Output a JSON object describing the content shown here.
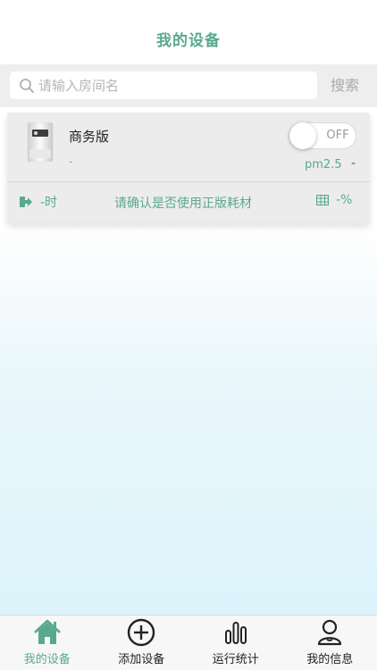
{
  "header": {
    "title": "我的设备"
  },
  "search": {
    "placeholder": "请输入房间名",
    "value": "",
    "button_label": "搜索"
  },
  "device": {
    "name": "商务版",
    "subtitle": "-",
    "power_state": "OFF",
    "pm_label": "pm2.5",
    "pm_value": "-",
    "hours_value": "-时",
    "notice": "请确认是否使用正版耗材",
    "filter_percent": "-%"
  },
  "tabs": [
    {
      "label": "我的设备",
      "icon": "home-icon",
      "active": true
    },
    {
      "label": "添加设备",
      "icon": "add-circle-icon",
      "active": false
    },
    {
      "label": "运行统计",
      "icon": "bar-chart-icon",
      "active": false
    },
    {
      "label": "我的信息",
      "icon": "user-icon",
      "active": false
    }
  ],
  "colors": {
    "accent": "#5aa98c",
    "card_bg": "#ececec",
    "tabbar_bg": "#f7f7f7"
  }
}
